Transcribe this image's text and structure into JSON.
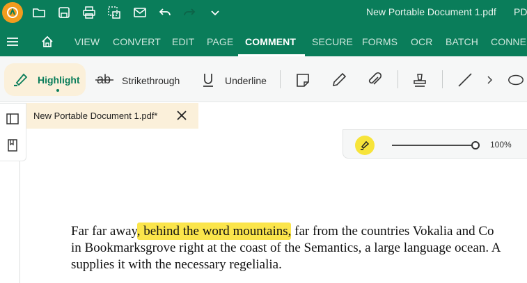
{
  "titlebar": {
    "document_title": "New Portable Document 1.pdf",
    "app_name_partial": "PD"
  },
  "menu": {
    "items": [
      "VIEW",
      "CONVERT",
      "EDIT",
      "PAGE",
      "COMMENT",
      "SECURE",
      "FORMS",
      "OCR",
      "BATCH",
      "CONNE"
    ],
    "active": "COMMENT"
  },
  "toolbar": {
    "highlight_label": "Highlight",
    "strikethrough_label": "Strikethrough",
    "underline_label": "Underline"
  },
  "tab": {
    "name": "New Portable Document 1.pdf*"
  },
  "zoom": {
    "value_label": "100%",
    "level": 1.0
  },
  "document": {
    "line1_before": "Far far away",
    "line1_highlight": ", behind the word mountains,",
    "line1_after": " far from the countries Vokalia and Co",
    "line2": "in Bookmarksgrove right at the coast of the Semantics, a large language ocean. A",
    "line3": "supplies it with the necessary regelialia."
  },
  "colors": {
    "brand_green": "#0a7d5a",
    "highlight_yellow": "#fbe54b",
    "active_tab_bg": "#fbf0da",
    "logo_orange": "#f39c1e"
  }
}
